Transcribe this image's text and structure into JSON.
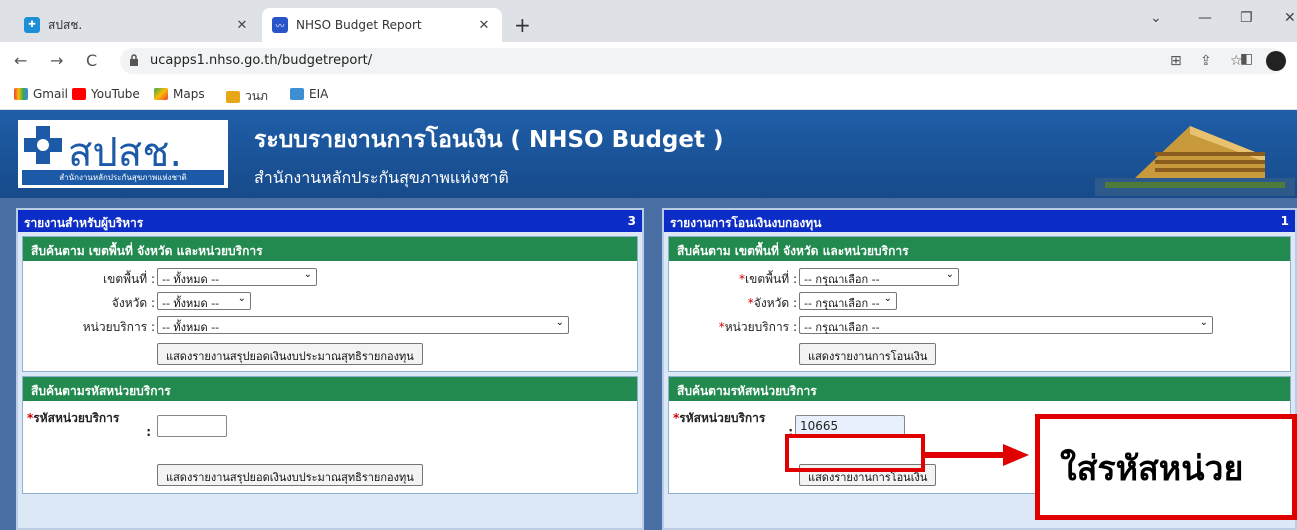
{
  "browser": {
    "tabs": [
      {
        "label": "สปสช.",
        "active": false
      },
      {
        "label": "NHSO Budget Report",
        "active": true
      }
    ],
    "url": "ucapps1.nhso.go.th/budgetreport/",
    "bookmarks": [
      "Gmail",
      "YouTube",
      "Maps",
      "วนภ",
      "EIA"
    ]
  },
  "header": {
    "logo_abbr": "สปสช.",
    "logo_full": "สำนักงานหลักประกันสุขภาพแห่งชาติ",
    "title": "ระบบรายงานการโอนเงิน ( NHSO Budget )",
    "subtitle": "สำนักงานหลักประกันสุขภาพแห่งชาติ"
  },
  "left_panel": {
    "title": "รายงานสำหรับผู้บริหาร",
    "count": "3",
    "area_section": {
      "heading": "สืบค้นตาม เขตพื้นที่ จังหวัด และหน่วยบริการ",
      "region_label": "เขตพื้นที่ :",
      "region_value": "-- ทั้งหมด --",
      "province_label": "จังหวัด :",
      "province_value": "-- ทั้งหมด --",
      "unit_label": "หน่วยบริการ :",
      "unit_value": "-- ทั้งหมด --",
      "button": "แสดงรายงานสรุปยอดเงินงบประมาณสุทธิรายกองทุน"
    },
    "code_section": {
      "heading": "สืบค้นตามรหัสหน่วยบริการ",
      "code_label": "รหัสหน่วยบริการ",
      "code_colon": ":",
      "code_value": "",
      "button": "แสดงรายงานสรุปยอดเงินงบประมาณสุทธิรายกองทุน"
    }
  },
  "right_panel": {
    "title": "รายงานการโอนเงินงบกองทุน",
    "count": "1",
    "area_section": {
      "heading": "สืบค้นตาม เขตพื้นที่ จังหวัด และหน่วยบริการ",
      "region_label": "เขตพื้นที่ :",
      "region_value": "-- กรุณาเลือก --",
      "province_label": "จังหวัด :",
      "province_value": "-- กรุณาเลือก --",
      "unit_label": "หน่วยบริการ :",
      "unit_value": "-- กรุณาเลือก --",
      "button": "แสดงรายงานการโอนเงิน"
    },
    "code_section": {
      "heading": "สืบค้นตามรหัสหน่วยบริการ",
      "code_label": "รหัสหน่วยบริการ",
      "code_colon": ":",
      "code_value": "10665",
      "button": "แสดงรายงานการโอนเงิน"
    }
  },
  "annotation": {
    "callout_text": "ใส่รหัสหน่วย",
    "color": "#e00000"
  },
  "colors": {
    "panel_title": "#0b2cc6",
    "section_head": "#238a4f",
    "header_bg": "#1f5ea8",
    "page_bg": "#4a6fa5"
  }
}
